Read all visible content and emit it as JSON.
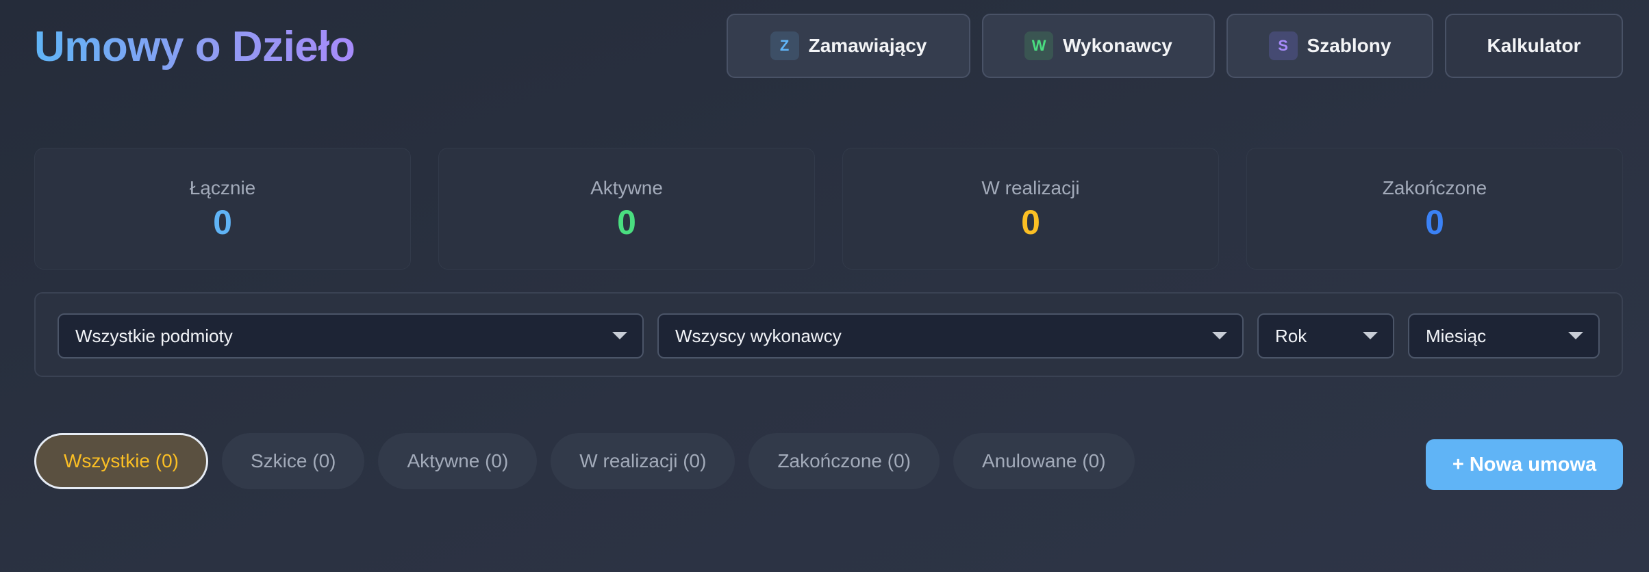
{
  "header": {
    "title": "Umowy o Dzieło",
    "nav": [
      {
        "badge": "Z",
        "label": "Zamawiający"
      },
      {
        "badge": "W",
        "label": "Wykonawcy"
      },
      {
        "badge": "S",
        "label": "Szablony"
      },
      {
        "label": "Kalkulator"
      }
    ]
  },
  "stats": [
    {
      "label": "Łącznie",
      "value": "0",
      "color": "#60b4f6"
    },
    {
      "label": "Aktywne",
      "value": "0",
      "color": "#4ade80"
    },
    {
      "label": "W realizacji",
      "value": "0",
      "color": "#fbbf24"
    },
    {
      "label": "Zakończone",
      "value": "0",
      "color": "#3b82f6"
    }
  ],
  "filters": {
    "entity": "Wszystkie podmioty",
    "contractor": "Wszyscy wykonawcy",
    "year": "Rok",
    "month": "Miesiąc"
  },
  "tabs": [
    {
      "label": "Wszystkie (0)",
      "active": true
    },
    {
      "label": "Szkice (0)"
    },
    {
      "label": "Aktywne (0)"
    },
    {
      "label": "W realizacji (0)"
    },
    {
      "label": "Zakończone (0)"
    },
    {
      "label": "Anulowane (0)"
    }
  ],
  "actions": {
    "new_contract": "+ Nowa umowa"
  },
  "colors": {
    "accent": "#60b4f6",
    "active_tab_text": "#fbbf24"
  }
}
